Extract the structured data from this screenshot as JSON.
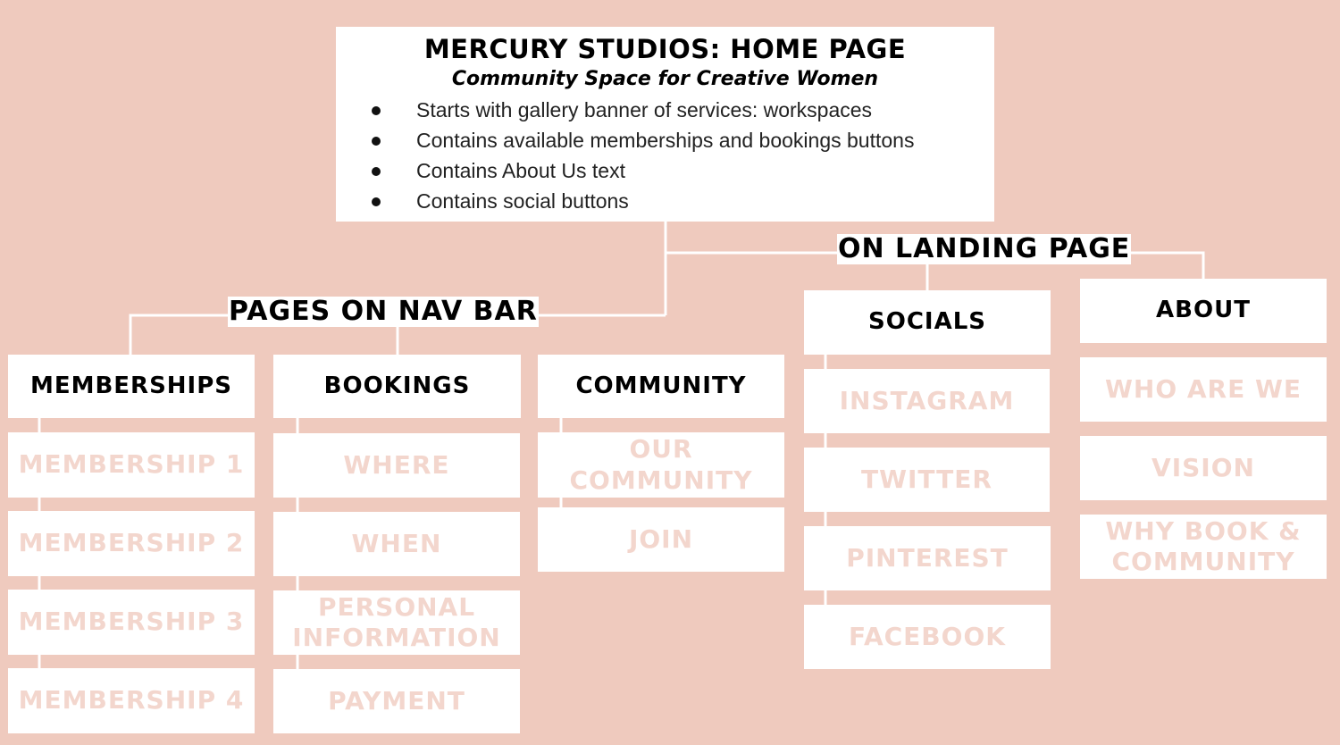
{
  "root": {
    "title": "MERCURY STUDIOS: HOME PAGE",
    "subtitle": "Community Space for Creative Women",
    "bullets": [
      "Starts with gallery banner of services: workspaces",
      "Contains available memberships and bookings buttons",
      "Contains About Us text",
      "Contains social buttons"
    ]
  },
  "groups": {
    "nav_bar_label": "PAGES ON NAV BAR",
    "landing_label": "ON LANDING PAGE"
  },
  "sections": {
    "memberships": {
      "title": "MEMBERSHIPS",
      "items": [
        "MEMBERSHIP 1",
        "MEMBERSHIP 2",
        "MEMBERSHIP 3",
        "MEMBERSHIP 4"
      ]
    },
    "bookings": {
      "title": "BOOKINGS",
      "items": [
        "WHERE",
        "WHEN",
        "PERSONAL INFORMATION",
        "PAYMENT"
      ]
    },
    "community": {
      "title": "COMMUNITY",
      "items": [
        "OUR COMMUNITY",
        "JOIN"
      ]
    },
    "socials": {
      "title": "SOCIALS",
      "items": [
        "INSTAGRAM",
        "TWITTER",
        "PINTEREST",
        "FACEBOOK"
      ]
    },
    "about": {
      "title": "ABOUT",
      "items": [
        "WHO ARE WE",
        "VISION",
        "WHY BOOK & COMMUNITY"
      ]
    }
  },
  "colors": {
    "background": "#efcabe",
    "box": "#ffffff",
    "leaf_text": "#f3d6cd",
    "heading_text": "#000000"
  }
}
